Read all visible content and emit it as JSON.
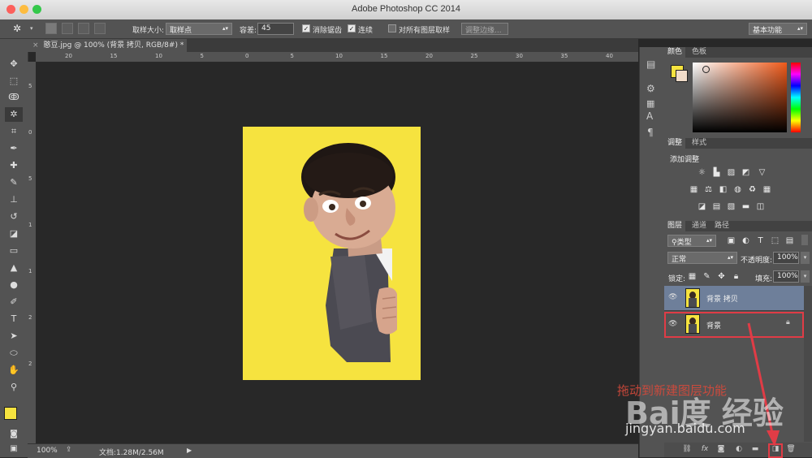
{
  "window": {
    "title": "Adobe Photoshop CC 2014"
  },
  "options": {
    "sample_size_label": "取样大小:",
    "sample_size_value": "取样点",
    "tolerance_label": "容差:",
    "tolerance_value": "45",
    "anti_alias_label": "消除锯齿",
    "contiguous_label": "连续",
    "sample_all_label": "对所有图层取样",
    "refine_edge_label": "调整边缘..."
  },
  "workspace": {
    "value": "基本功能"
  },
  "document_tab": {
    "label": "憨豆.jpg @ 100% (背景 拷贝, RGB/8#) *"
  },
  "ruler": {
    "h_ticks": [
      "20",
      "15",
      "10",
      "5",
      "0",
      "5",
      "10",
      "15",
      "20",
      "25",
      "30",
      "35",
      "40",
      "45"
    ],
    "v_ticks": [
      "5",
      "0",
      "5",
      "1",
      "1",
      "2",
      "2"
    ]
  },
  "status": {
    "zoom": "100%",
    "doc_info": "文档:1.28M/2.56M"
  },
  "color_panel": {
    "tab_color": "颜色",
    "tab_swatches": "色板",
    "fg_color": "#f6e33f"
  },
  "adjust_panel": {
    "tab_adjust": "调整",
    "tab_styles": "样式",
    "heading": "添加调整"
  },
  "layers_panel": {
    "tab_layers": "图层",
    "tab_channels": "通道",
    "tab_paths": "路径",
    "filter_kind": "类型",
    "blend_mode": "正常",
    "opacity_label": "不透明度:",
    "opacity_value": "100%",
    "lock_label": "锁定:",
    "fill_label": "填充:",
    "fill_value": "100%",
    "layers": [
      {
        "name": "背景 拷贝",
        "selected": true
      },
      {
        "name": "背景",
        "selected": false,
        "locked": true
      }
    ]
  },
  "annotation": {
    "text": "拖动到新建图层功能",
    "color": "#e8394a"
  },
  "watermark": {
    "logo": "Bai度 经验",
    "url": "jingyan.baidu.com"
  }
}
